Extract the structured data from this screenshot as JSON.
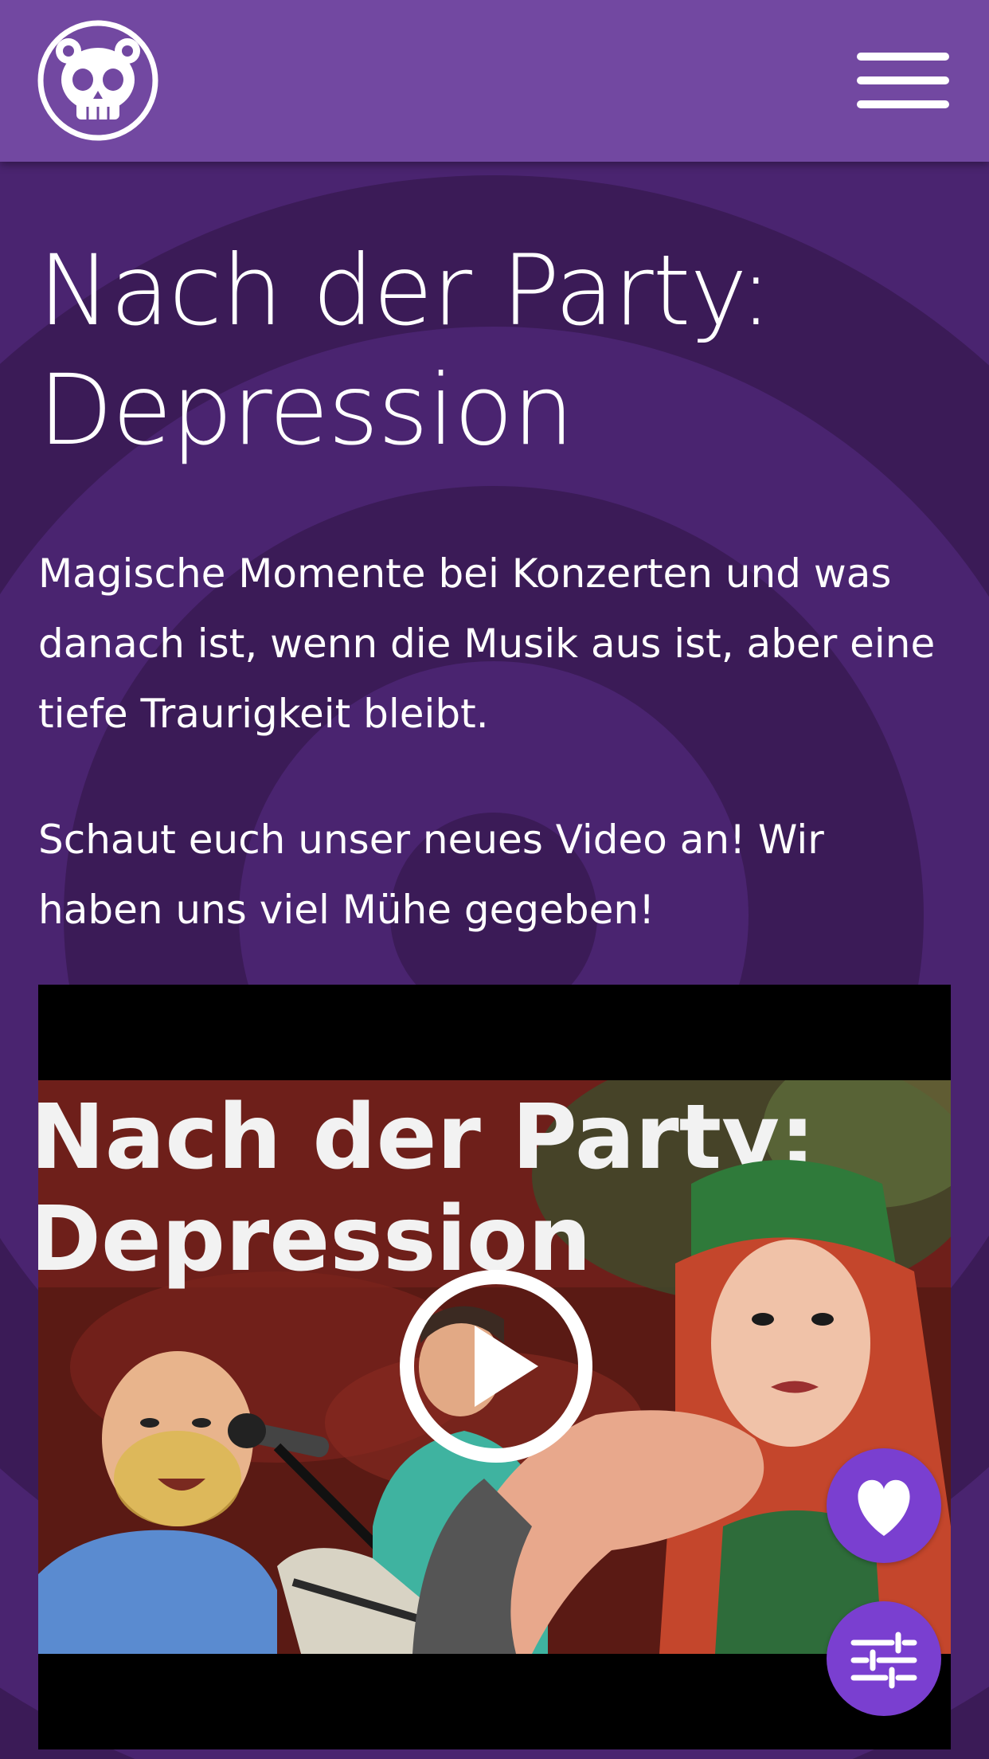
{
  "header": {
    "logo_icon": "skull-bear-logo-icon",
    "menu_icon": "hamburger-menu-icon",
    "color": "#7248a1"
  },
  "main": {
    "title": "Nach der Party: Depression",
    "paragraph_1": "Magische Momente bei Konzerten und was danach ist, wenn die Musik aus ist, aber eine tiefe Traurigkeit bleibt.",
    "paragraph_2": "Schaut euch unser neues Video an! Wir haben uns viel Mühe gegeben!"
  },
  "video": {
    "thumbnail_title_line1": "Nach der Party:",
    "thumbnail_title_line2": "Depression",
    "play_icon": "play-icon"
  },
  "fabs": {
    "like_icon": "heart-icon",
    "settings_icon": "sliders-icon",
    "color": "#7a3fd0"
  },
  "colors": {
    "background": "#3e1f5c",
    "ring": "#4a2470",
    "text": "#ffffff"
  }
}
